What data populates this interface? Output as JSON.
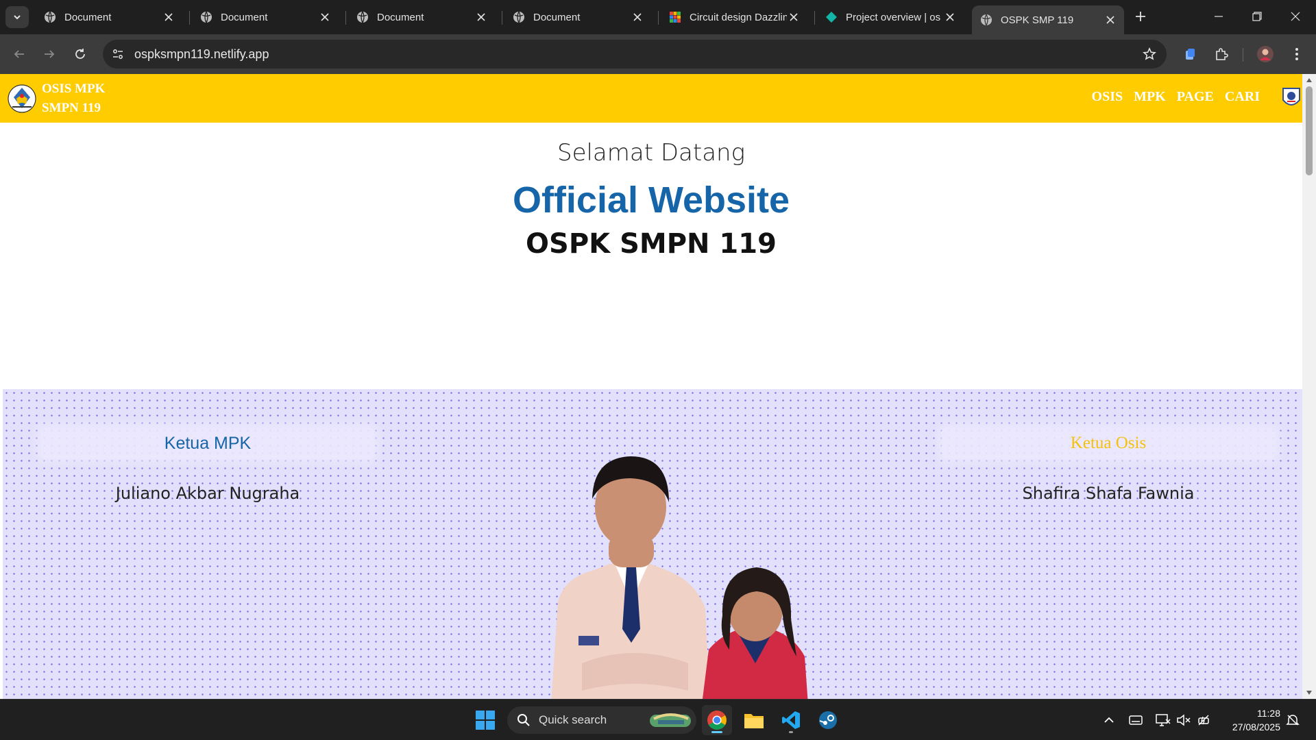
{
  "browser": {
    "tabs": [
      {
        "title": "Document",
        "icon": "globe-icon"
      },
      {
        "title": "Document",
        "icon": "globe-icon"
      },
      {
        "title": "Document",
        "icon": "globe-icon"
      },
      {
        "title": "Document",
        "icon": "globe-icon"
      },
      {
        "title": "Circuit design Dazzlin",
        "icon": "tinkercad-icon"
      },
      {
        "title": "Project overview | os",
        "icon": "diamond-icon"
      },
      {
        "title": "OSPK SMP 119",
        "icon": "globe-icon",
        "active": true
      }
    ],
    "url": "ospksmpn119.netlify.app"
  },
  "site": {
    "brand_line1": "OSIS MPK",
    "brand_line2": "SMPN 119",
    "nav": [
      "OSIS",
      "MPK",
      "PAGE",
      "CARI"
    ],
    "colors": {
      "header": "#ffcc00",
      "title_blue": "#1565a8",
      "osis_yellow": "#f4c20d"
    }
  },
  "hero": {
    "welcome": "Selamat Datang",
    "official": "Official Website",
    "school": "OSPK SMPN 119"
  },
  "leaders": {
    "mpk_role": "Ketua MPK",
    "mpk_name": "Juliano Akbar Nugraha",
    "osis_role": "Ketua Osis",
    "osis_name": "Shafira Shafa Fawnia"
  },
  "taskbar": {
    "search_label": "Quick search",
    "time": "11:28",
    "date": "27/08/2025"
  }
}
